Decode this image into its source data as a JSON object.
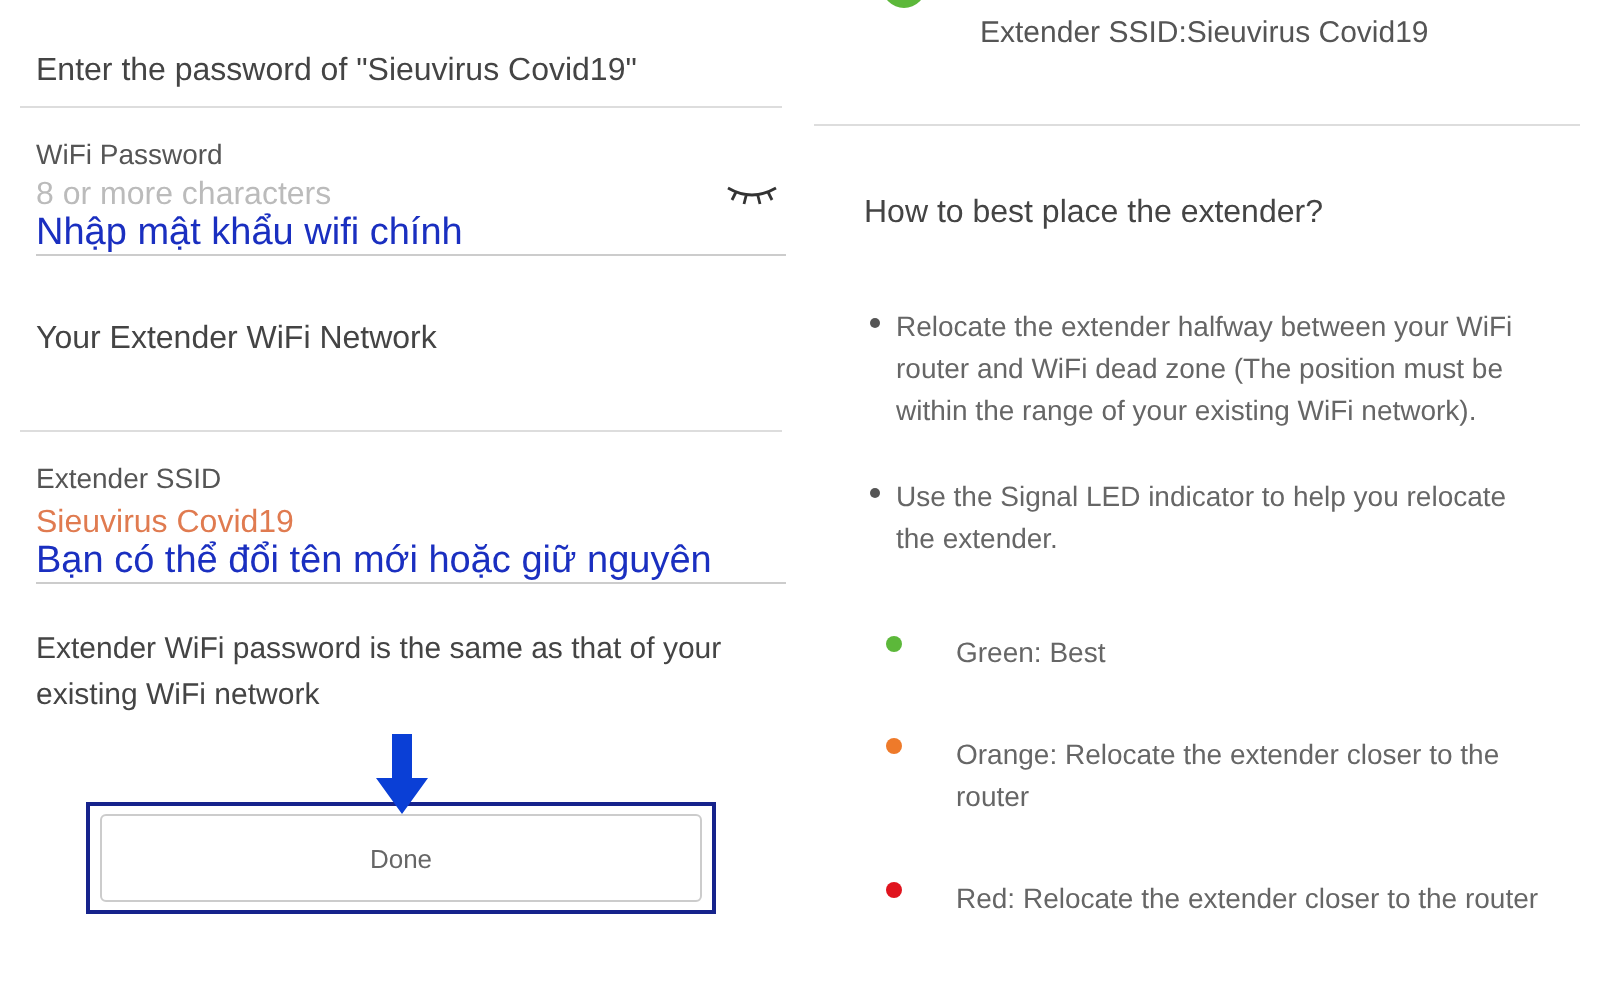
{
  "left_screen": {
    "prompt": "Enter the password of \"Sieuvirus Covid19\"",
    "password_field": {
      "label": "WiFi Password",
      "placeholder": "8 or more characters",
      "annotation": "Nhập mật khẩu wifi chính"
    },
    "section_title": "Your Extender WiFi Network",
    "ssid_field": {
      "label": "Extender SSID",
      "value": "Sieuvirus Covid19",
      "annotation": "Bạn có thể đổi tên mới hoặc giữ nguyên"
    },
    "note": "Extender WiFi password is the same as that of your existing WiFi network",
    "done_button": {
      "label": "Done",
      "highlighted": true
    }
  },
  "right_screen": {
    "ssid_line": "Extender SSID:Sieuvirus Covid19",
    "heading": "How to best place the extender?",
    "tips": [
      "Relocate the extender halfway between your WiFi router and WiFi dead zone (The position must be within the range of your existing WiFi network).",
      "Use the Signal LED indicator to help you relocate the extender."
    ],
    "led_states": [
      {
        "color": "#5cb83a",
        "text": "Green: Best"
      },
      {
        "color": "#ee7a2a",
        "text": "Orange: Relocate the extender closer to the router"
      },
      {
        "color": "#e0141e",
        "text": "Red: Relocate the extender closer to the router"
      }
    ]
  }
}
